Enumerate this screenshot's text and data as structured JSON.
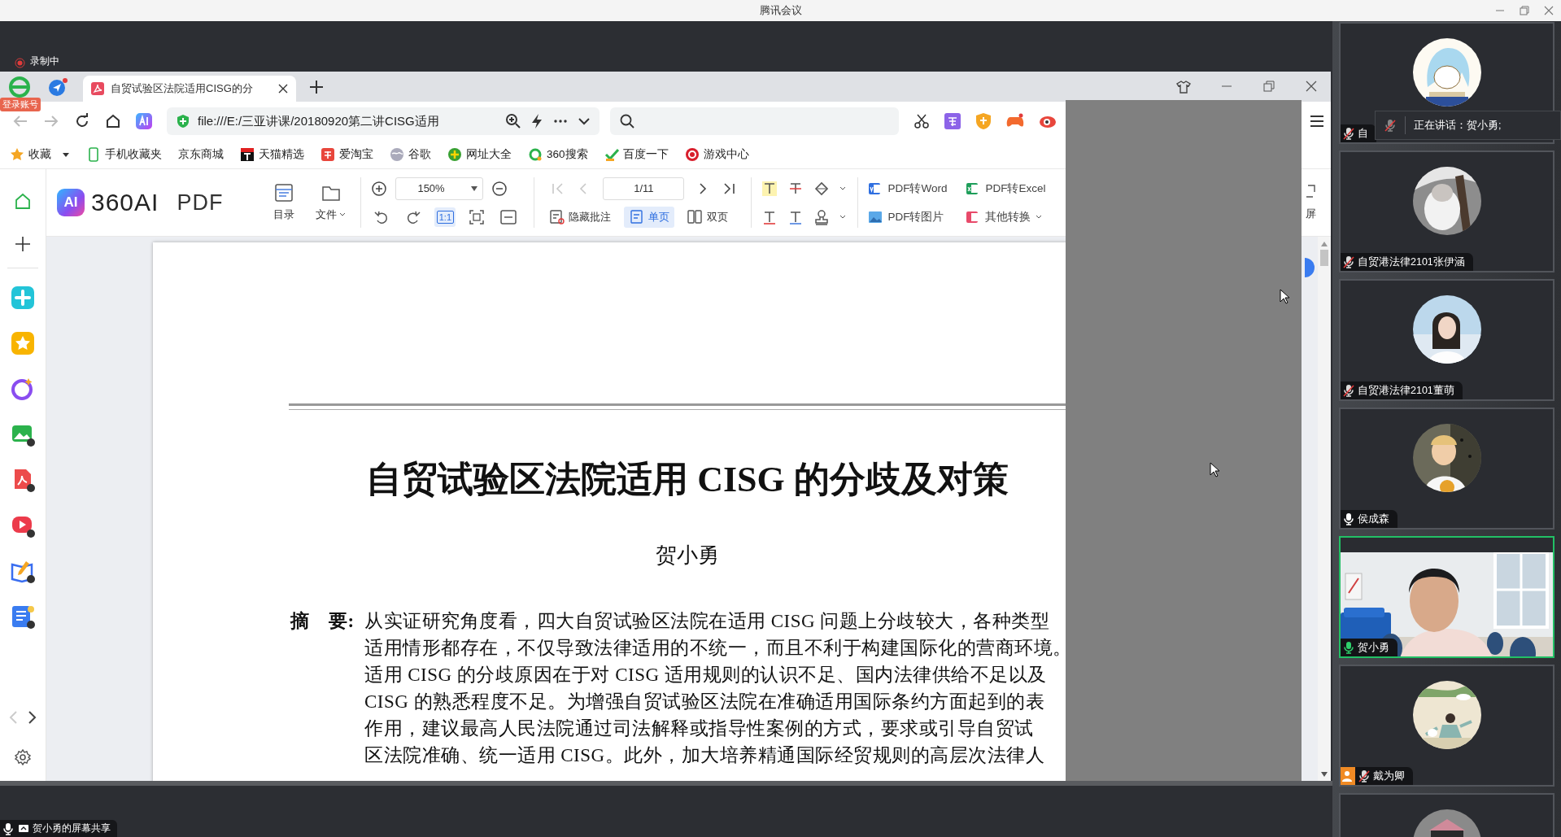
{
  "window": {
    "title": "腾讯会议"
  },
  "recording": {
    "label": "录制中"
  },
  "browser": {
    "tabs": [
      {
        "title": "自贸试验区法院适用CISG的分",
        "selected": true
      }
    ],
    "login_badge": "登录账号",
    "address": "file:///E:/三亚讲课/20180920第二讲CISG适用",
    "bookmarks": [
      {
        "label": "收藏",
        "dropdown": true
      },
      {
        "label": "手机收藏夹",
        "dropdown": false
      },
      {
        "label": "京东商城",
        "dropdown": false
      },
      {
        "label": "天猫精选",
        "dropdown": false
      },
      {
        "label": "爱淘宝",
        "dropdown": false
      },
      {
        "label": "谷歌",
        "dropdown": false
      },
      {
        "label": "网址大全",
        "dropdown": false
      },
      {
        "label": "360搜索",
        "dropdown": false
      },
      {
        "label": "百度一下",
        "dropdown": false
      },
      {
        "label": "游戏中心",
        "dropdown": false
      }
    ]
  },
  "pdf_viewer": {
    "logo": {
      "badge": "AI",
      "name": "360AI",
      "suffix": "PDF"
    },
    "menu_buttons": [
      {
        "label": "目录",
        "dropdown": false
      },
      {
        "label": "文件",
        "dropdown": true
      }
    ],
    "zoom": "150%",
    "view_buttons": [
      {
        "kind": "rotate-left",
        "selected": false
      },
      {
        "kind": "rotate-right",
        "selected": false
      },
      {
        "kind": "actual-size",
        "label": "1:1",
        "selected": true
      },
      {
        "kind": "fit-page",
        "selected": false
      },
      {
        "kind": "fit-width",
        "selected": false
      }
    ],
    "page_nav": [
      {
        "kind": "first",
        "disabled": true
      },
      {
        "kind": "prev",
        "disabled": true
      },
      {
        "kind": "next",
        "disabled": false
      },
      {
        "kind": "last",
        "disabled": false
      }
    ],
    "page_field": "1/11",
    "layout_buttons": [
      {
        "label": "隐藏批注",
        "selected": false
      },
      {
        "label": "单页",
        "selected": true
      },
      {
        "label": "双页",
        "selected": false
      }
    ],
    "convert_buttons": [
      {
        "label": "PDF转Word",
        "dropdown": false
      },
      {
        "label": "PDF转Excel",
        "dropdown": false
      },
      {
        "label": "PDF转图片",
        "dropdown": false
      },
      {
        "label": "其他转换",
        "dropdown": true
      }
    ],
    "fullscreen_label": "屏",
    "document": {
      "title": "自贸试验区法院适用 CISG 的分歧及对策",
      "author": "贺小勇",
      "abstract_label": "摘　要:",
      "abstract_lines": [
        "从实证研究角度看，四大自贸试验区法院在适用 CISG 问题上分歧较大，各种类型",
        "适用情形都存在，不仅导致法律适用的不统一，而且不利于构建国际化的营商环境。",
        "适用 CISG 的分歧原因在于对 CISG 适用规则的认识不足、国内法律供给不足以及",
        "CISG 的熟悉程度不足。为增强自贸试验区法院在准确适用国际条约方面起到的表",
        "作用，建议最高人民法院通过司法解释或指导性案例的方式，要求或引导自贸试",
        "区法院准确、统一适用 CISG。此外，加大培养精通国际经贸规则的高层次法律人"
      ]
    }
  },
  "speaking_banner": {
    "text": "正在讲话：贺小勇;",
    "muted": true
  },
  "participants": [
    {
      "kind": "avatar",
      "name": "自",
      "muted": true,
      "speaking": false,
      "host": false,
      "highlighted": false
    },
    {
      "kind": "avatar",
      "name": "自贸港法律2101张伊涵",
      "muted": true,
      "speaking": false,
      "host": false,
      "highlighted": false
    },
    {
      "kind": "avatar",
      "name": "自贸港法律2101董萌",
      "muted": true,
      "speaking": false,
      "host": false,
      "highlighted": false
    },
    {
      "kind": "avatar",
      "name": "侯成森",
      "muted": false,
      "speaking": false,
      "host": false,
      "highlighted": false
    },
    {
      "kind": "video",
      "name": "贺小勇",
      "muted": false,
      "speaking": true,
      "host": false,
      "highlighted": true
    },
    {
      "kind": "avatar",
      "name": "戴为卿",
      "muted": true,
      "speaking": false,
      "host": true,
      "highlighted": false
    },
    {
      "kind": "avatar",
      "highlighted": false
    }
  ],
  "share_label": "贺小勇的屏幕共享"
}
